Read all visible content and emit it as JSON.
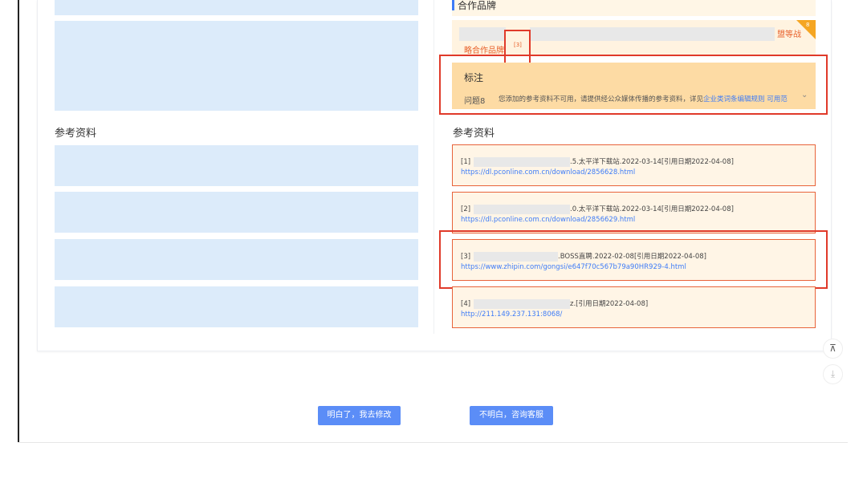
{
  "left_column": {
    "references_title": "参考资料"
  },
  "brand_section": {
    "title": "合作品牌",
    "right_text": "盟等战",
    "corner_badge": "8",
    "label": "略合作品牌",
    "citation": "[3]"
  },
  "note": {
    "title": "标注",
    "issue_label": "问题8",
    "text": "您添加的参考资料不可用，请提供经公众媒体传播的参考资料，详见",
    "link_text": "企业类词条编辑规则 可用范",
    "chevron": "⌄"
  },
  "references": {
    "title": "参考资料",
    "items": [
      {
        "index": "[1]",
        "text": ".5.太平洋下载站.2022-03-14[引用日期2022-04-08]",
        "url": "https://dl.pconline.com.cn/download/2856628.html"
      },
      {
        "index": "[2]",
        "text": ".0.太平洋下载站.2022-03-14[引用日期2022-04-08]",
        "url": "https://dl.pconline.com.cn/download/2856629.html"
      },
      {
        "index": "[3]",
        "text": ".BOSS直聘.2022-02-08[引用日期2022-04-08]",
        "url": "https://www.zhipin.com/gongsi/e647f70c567b79a90HR929-4.html"
      },
      {
        "index": "[4]",
        "text": "z.[引用日期2022-04-08]",
        "url": "http://211.149.237.131:8068/"
      }
    ]
  },
  "side_tools": {
    "top_icon": "⊼",
    "download_icon": "⤓"
  },
  "actions": {
    "understand_label": "明白了，我去修改",
    "consult_label": "不明白，咨询客服"
  }
}
